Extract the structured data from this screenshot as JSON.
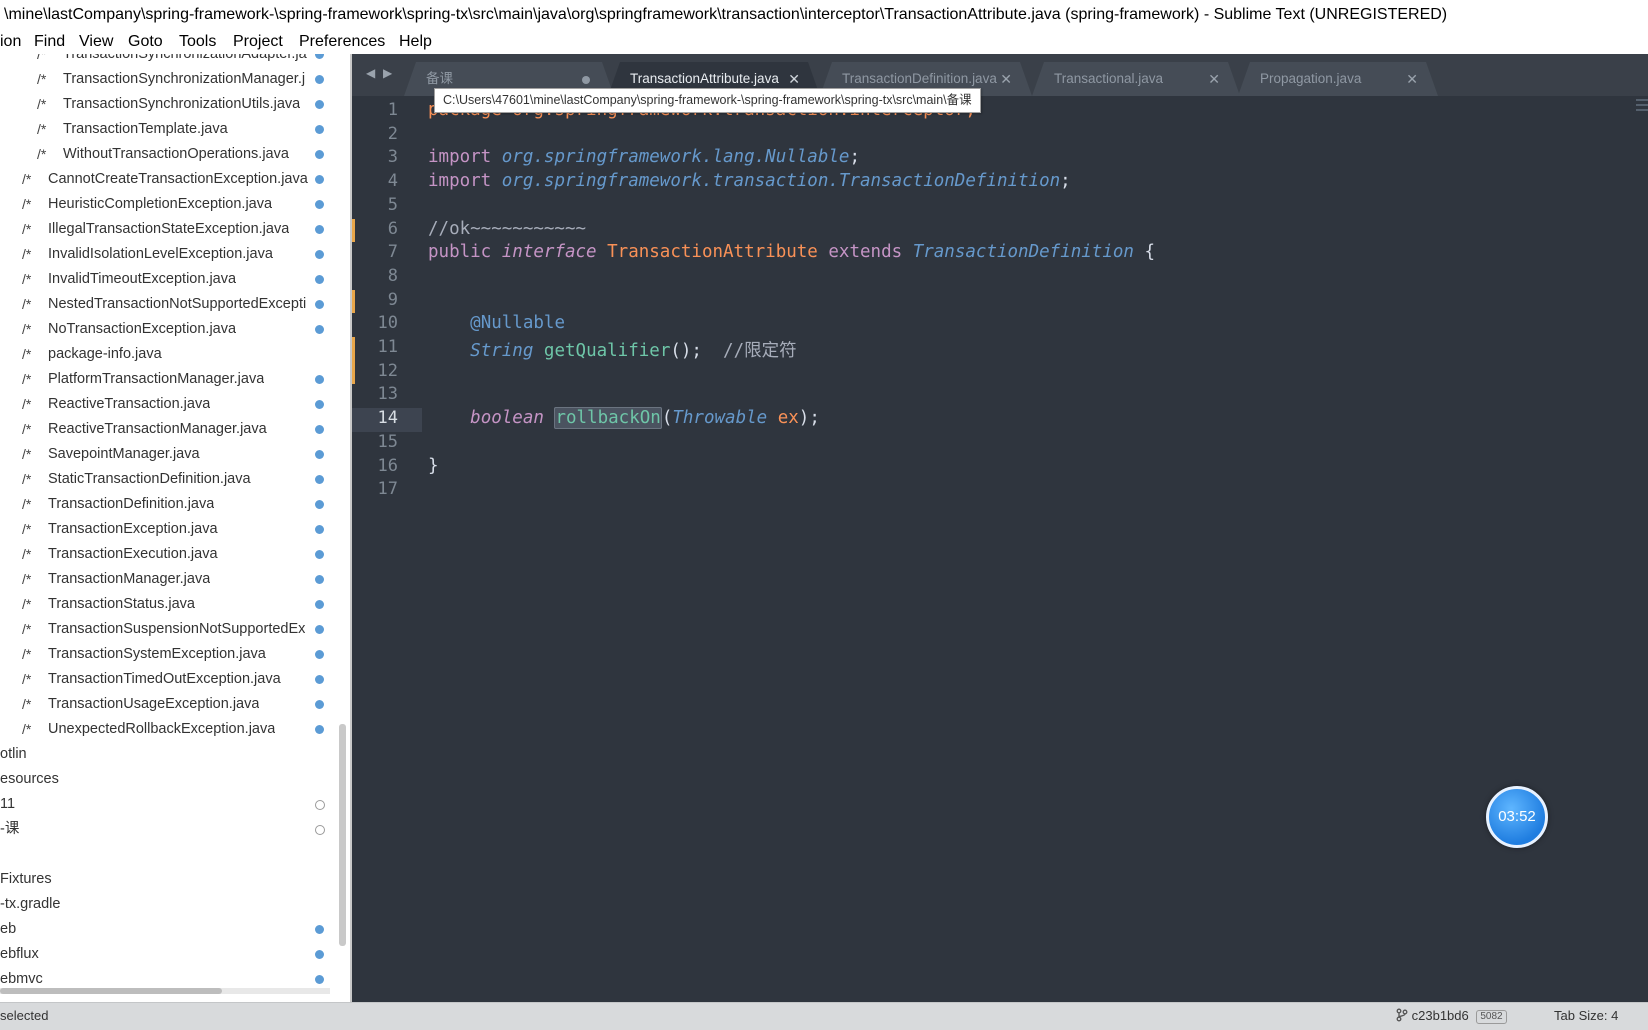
{
  "window": {
    "title": "\\mine\\lastCompany\\spring-framework-\\spring-framework\\spring-tx\\src\\main\\java\\org\\springframework\\transaction\\interceptor\\TransactionAttribute.java (spring-framework) - Sublime Text (UNREGISTERED)"
  },
  "menu": [
    "ion",
    "Find",
    "View",
    "Goto",
    "Tools",
    "Project",
    "Preferences",
    "Help"
  ],
  "sidebar": {
    "items": [
      {
        "label": "TransactionSynchronizationAdapter.ja",
        "dot": true,
        "indent": 2
      },
      {
        "label": "TransactionSynchronizationManager.j",
        "dot": true,
        "indent": 2
      },
      {
        "label": "TransactionSynchronizationUtils.java",
        "dot": true,
        "indent": 2
      },
      {
        "label": "TransactionTemplate.java",
        "dot": true,
        "indent": 2
      },
      {
        "label": "WithoutTransactionOperations.java",
        "dot": true,
        "indent": 2
      },
      {
        "label": "CannotCreateTransactionException.java",
        "dot": true,
        "indent": 1
      },
      {
        "label": "HeuristicCompletionException.java",
        "dot": true,
        "indent": 1
      },
      {
        "label": "IllegalTransactionStateException.java",
        "dot": true,
        "indent": 1
      },
      {
        "label": "InvalidIsolationLevelException.java",
        "dot": true,
        "indent": 1
      },
      {
        "label": "InvalidTimeoutException.java",
        "dot": true,
        "indent": 1
      },
      {
        "label": "NestedTransactionNotSupportedExcepti",
        "dot": true,
        "indent": 1
      },
      {
        "label": "NoTransactionException.java",
        "dot": true,
        "indent": 1
      },
      {
        "label": "package-info.java",
        "dot": false,
        "indent": 1
      },
      {
        "label": "PlatformTransactionManager.java",
        "dot": true,
        "indent": 1
      },
      {
        "label": "ReactiveTransaction.java",
        "dot": true,
        "indent": 1
      },
      {
        "label": "ReactiveTransactionManager.java",
        "dot": true,
        "indent": 1
      },
      {
        "label": "SavepointManager.java",
        "dot": true,
        "indent": 1
      },
      {
        "label": "StaticTransactionDefinition.java",
        "dot": true,
        "indent": 1
      },
      {
        "label": "TransactionDefinition.java",
        "dot": true,
        "indent": 1
      },
      {
        "label": "TransactionException.java",
        "dot": true,
        "indent": 1
      },
      {
        "label": "TransactionExecution.java",
        "dot": true,
        "indent": 1
      },
      {
        "label": "TransactionManager.java",
        "dot": true,
        "indent": 1
      },
      {
        "label": "TransactionStatus.java",
        "dot": true,
        "indent": 1
      },
      {
        "label": "TransactionSuspensionNotSupportedEx",
        "dot": true,
        "indent": 1
      },
      {
        "label": "TransactionSystemException.java",
        "dot": true,
        "indent": 1
      },
      {
        "label": "TransactionTimedOutException.java",
        "dot": true,
        "indent": 1
      },
      {
        "label": "TransactionUsageException.java",
        "dot": true,
        "indent": 1
      },
      {
        "label": "UnexpectedRollbackException.java",
        "dot": true,
        "indent": 1
      },
      {
        "label": "otlin",
        "dot": false,
        "indent": 0
      },
      {
        "label": "esources",
        "dot": false,
        "indent": 0
      },
      {
        "label": "11",
        "dot": false,
        "ring": true,
        "indent": 0
      },
      {
        "label": "-课",
        "dot": false,
        "ring": true,
        "indent": 0
      },
      {
        "label": "",
        "dot": false,
        "indent": 0
      },
      {
        "label": "Fixtures",
        "dot": false,
        "indent": 0
      },
      {
        "label": "-tx.gradle",
        "dot": false,
        "indent": 0
      },
      {
        "label": "eb",
        "dot": true,
        "indent": 0
      },
      {
        "label": "ebflux",
        "dot": true,
        "indent": 0
      },
      {
        "label": "ebmvc",
        "dot": true,
        "indent": 0
      }
    ],
    "file_icon": "/*"
  },
  "tabs": [
    {
      "label": "备课",
      "active": false,
      "dirty": true
    },
    {
      "label": "TransactionAttribute.java",
      "active": true,
      "dirty": false
    },
    {
      "label": "TransactionDefinition.java",
      "active": false,
      "dirty": false
    },
    {
      "label": "Transactional.java",
      "active": false,
      "dirty": false
    },
    {
      "label": "Propagation.java",
      "active": false,
      "dirty": false
    }
  ],
  "tab_close_glyph": "✕",
  "nav": {
    "back": "◀",
    "forward": "▶"
  },
  "tooltip": "C:\\Users\\47601\\mine\\lastCompany\\spring-framework-\\spring-framework\\spring-tx\\src\\main\\备课",
  "editor": {
    "line_numbers": [
      "1",
      "2",
      "3",
      "4",
      "5",
      "6",
      "7",
      "8",
      "9",
      "10",
      "11",
      "12",
      "13",
      "14",
      "15",
      "16",
      "17"
    ],
    "current_line": 14,
    "lines": [
      [
        {
          "t": "package org.springframework.transaction.interceptor;",
          "c": "hidden-under"
        }
      ],
      [],
      [
        {
          "t": "import ",
          "c": "kw"
        },
        {
          "t": "org.springframework.lang.Nullable",
          "c": "pkg"
        },
        {
          "t": ";",
          "c": "pun"
        }
      ],
      [
        {
          "t": "import ",
          "c": "kw"
        },
        {
          "t": "org.springframework.transaction.TransactionDefinition",
          "c": "pkg"
        },
        {
          "t": ";",
          "c": "pun"
        }
      ],
      [],
      [
        {
          "t": "//ok~~~~~~~~~~~",
          "c": "cmt"
        }
      ],
      [
        {
          "t": "public ",
          "c": "kw"
        },
        {
          "t": "interface ",
          "c": "kwi"
        },
        {
          "t": "TransactionAttribute ",
          "c": "cls"
        },
        {
          "t": "extends ",
          "c": "kw"
        },
        {
          "t": "TransactionDefinition",
          "c": "typ"
        },
        {
          "t": " {",
          "c": "pun"
        }
      ],
      [],
      [],
      [
        {
          "t": "    ",
          "c": "pun"
        },
        {
          "t": "@Nullable",
          "c": "ann"
        }
      ],
      [
        {
          "t": "    ",
          "c": "pun"
        },
        {
          "t": "String ",
          "c": "typ"
        },
        {
          "t": "getQualifier",
          "c": "fn"
        },
        {
          "t": "();  ",
          "c": "pun"
        },
        {
          "t": "//限定符",
          "c": "cmt"
        }
      ],
      [],
      [],
      [
        {
          "t": "    ",
          "c": "pun"
        },
        {
          "t": "boolean ",
          "c": "kwi"
        },
        {
          "t": "rollbackOn",
          "c": "fn selbox"
        },
        {
          "t": "(",
          "c": "pun"
        },
        {
          "t": "Throwable ",
          "c": "typ"
        },
        {
          "t": "ex",
          "c": "prm"
        },
        {
          "t": ");",
          "c": "pun"
        }
      ],
      [],
      [
        {
          "t": "}",
          "c": "pun"
        }
      ],
      []
    ]
  },
  "timer": "03:52",
  "status": {
    "left": "selected",
    "branch_icon": "git-branch-icon",
    "branch": "c23b1bd6",
    "commits": "5082",
    "tab_size": "Tab Size: 4"
  }
}
